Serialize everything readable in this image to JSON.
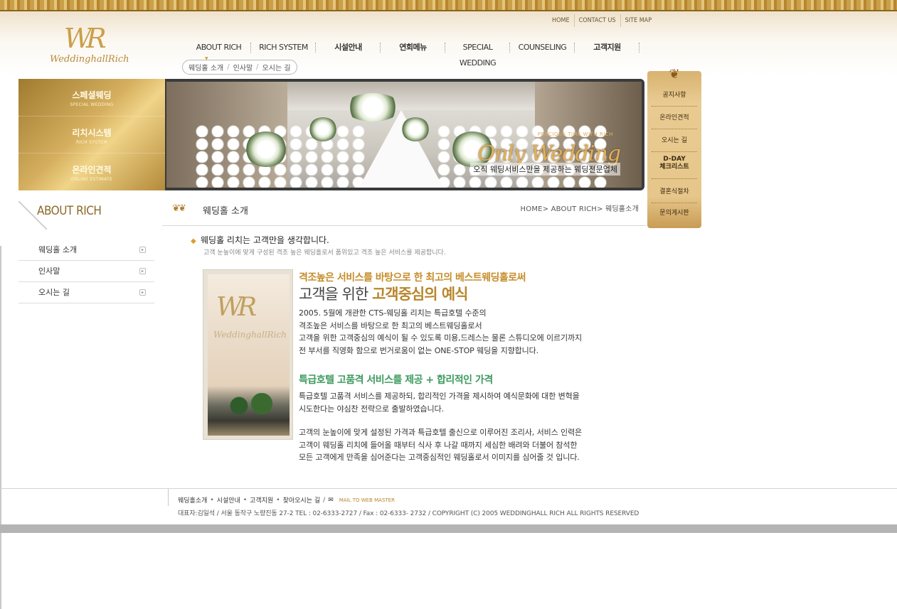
{
  "header": {
    "logo_text": "WeddinghallRich",
    "util_nav": [
      "HOME",
      "CONTACT US",
      "SITE MAP"
    ],
    "main_nav": [
      {
        "label": "ABOUT RICH"
      },
      {
        "label": "RICH SYSTEM"
      },
      {
        "label": "시설안내"
      },
      {
        "label": "연회메뉴"
      },
      {
        "label": "SPECIAL WEDDING"
      },
      {
        "label": "COUNSELING"
      },
      {
        "label": "고객지원"
      }
    ],
    "sub_nav": [
      "웨딩홀 소개",
      "인사말",
      "오시는 길"
    ],
    "sub_nav_sep": "/"
  },
  "banner": {
    "menu": [
      {
        "ko": "스페셜웨딩",
        "en": "SPECIAL WEDDING"
      },
      {
        "ko": "리치시스템",
        "en": "RICH SYSTEM"
      },
      {
        "ko": "온라인견적",
        "en": "ONLINE ESTIMATE"
      }
    ],
    "tagline_small": "PRECIOUS TIME WITH RICH",
    "tagline_big": "Only Wedding",
    "tagline_sub": "오직 웨딩서비스만을 제공하는 웨딩전문업체"
  },
  "quick_menu": [
    "공지사항",
    "온라인견적",
    "오시는 길",
    "D-DAY",
    "체크리스트",
    "결혼식절차",
    "문의게시판"
  ],
  "sidebar": {
    "title": "ABOUT RICH",
    "items": [
      "웨딩홀 소개",
      "인사말",
      "오시는 길"
    ]
  },
  "content": {
    "title": "웨딩홀 소개",
    "breadcrumb": "HOME> ABOUT RICH> 웨딩홀소개",
    "intro_heading": "웨딩홀 리치는 고객만을 생각합니다.",
    "intro_sub": "고객 눈높이에 맞게 구성된 격조 높은 웨딩홀로서 품위있고 격조 높은 서비스를 제공합니다.",
    "photo_mark": "WR",
    "photo_text": "WeddinghallRich",
    "heading_gold": "격조높은 서비스를 바탕으로 한 최고의 베스트웨딩홀로써",
    "heading_big_a": "고객을 위한 ",
    "heading_big_b": "고객중심의 예식",
    "para1": [
      "2005. 5월에 개관한 CTS-웨딩홀 리치는 특급호텔 수준의",
      "격조높은 서비스를 바탕으로 한 최고의 베스트웨딩홀로서",
      "고객을 위한 고객중심의 예식이 될 수 있도록 미용,드레스는 물론 스튜디오에 이르기까지",
      "전 부서를 직영화 함으로 번거로움이 없는 ONE-STOP 웨딩을 지향합니다."
    ],
    "heading_green": "특급호텔 고품격 서비스를 제공 + 합리적인 가격",
    "para2": [
      "특급호텔 고품격 서비스를 제공하되, 합리적인 가격을 제시하여 예식문화에 대한 변혁을",
      "시도한다는 야심찬 전략으로 출발하였습니다."
    ],
    "para3": [
      "고객의 눈높이에 맞게 설정된 가격과 특급호텔 출신으로 이루어진 조리사, 서비스 인력은",
      "고객이 웨딩홀 리치에 들어올 때부터 식사 후 나갈 때까지 세심한 배려와 더불어 참석한",
      "모든 고객에게 만족을 심어준다는 고객중심적인 웨딩홀로서 이미지를 심어줄 것 입니다."
    ]
  },
  "footer": {
    "links": [
      "웨딩홀소개",
      "시설안내",
      "고객지원",
      "찾아오시는 길"
    ],
    "mail": "MAIL TO WEB MASTER",
    "info": "대표자:김일석 / 서울 동작구 노량진동 27-2   TEL : 02-6333-2727  /  Fax : 02-6333- 2732  /  COPYRIGHT (C) 2005 WEDDINGHALL RICH  ALL RIGHTS RESERVED"
  }
}
